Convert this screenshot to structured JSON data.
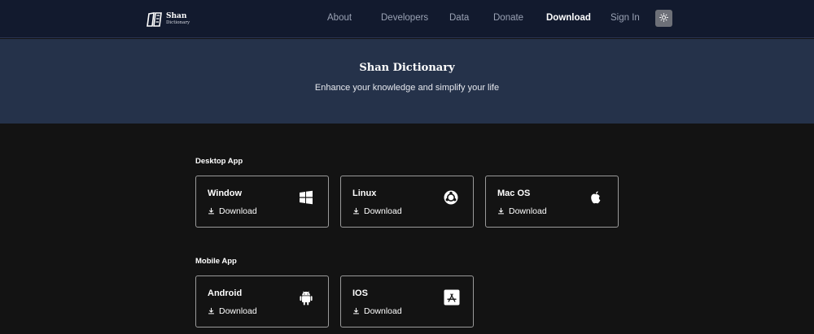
{
  "brand": {
    "title": "Shan",
    "subtitle": "Dictionary"
  },
  "nav": {
    "items": [
      {
        "label": "About"
      },
      {
        "label": "Developers"
      },
      {
        "label": "Data"
      },
      {
        "label": "Donate"
      },
      {
        "label": "Download",
        "active": true
      },
      {
        "label": "Sign In"
      }
    ],
    "theme_icon": "sun-icon"
  },
  "hero": {
    "title": "Shan Dictionary",
    "subtitle": "Enhance your knowledge and simplify your life"
  },
  "desktop": {
    "heading": "Desktop App",
    "apps": [
      {
        "name": "Window",
        "download_label": "Download",
        "icon": "windows-icon"
      },
      {
        "name": "Linux",
        "download_label": "Download",
        "icon": "ubuntu-icon"
      },
      {
        "name": "Mac OS",
        "download_label": "Download",
        "icon": "apple-icon"
      }
    ]
  },
  "mobile": {
    "heading": "Mobile App",
    "apps": [
      {
        "name": "Android",
        "download_label": "Download",
        "icon": "android-icon"
      },
      {
        "name": "IOS",
        "download_label": "Download",
        "icon": "app-store-icon"
      }
    ]
  },
  "colors": {
    "navbar_bg": "#121a2e",
    "hero_bg": "#25324a",
    "page_bg": "#131313",
    "card_border": "#9a9a9a",
    "nav_inactive": "#9aa2b4"
  }
}
